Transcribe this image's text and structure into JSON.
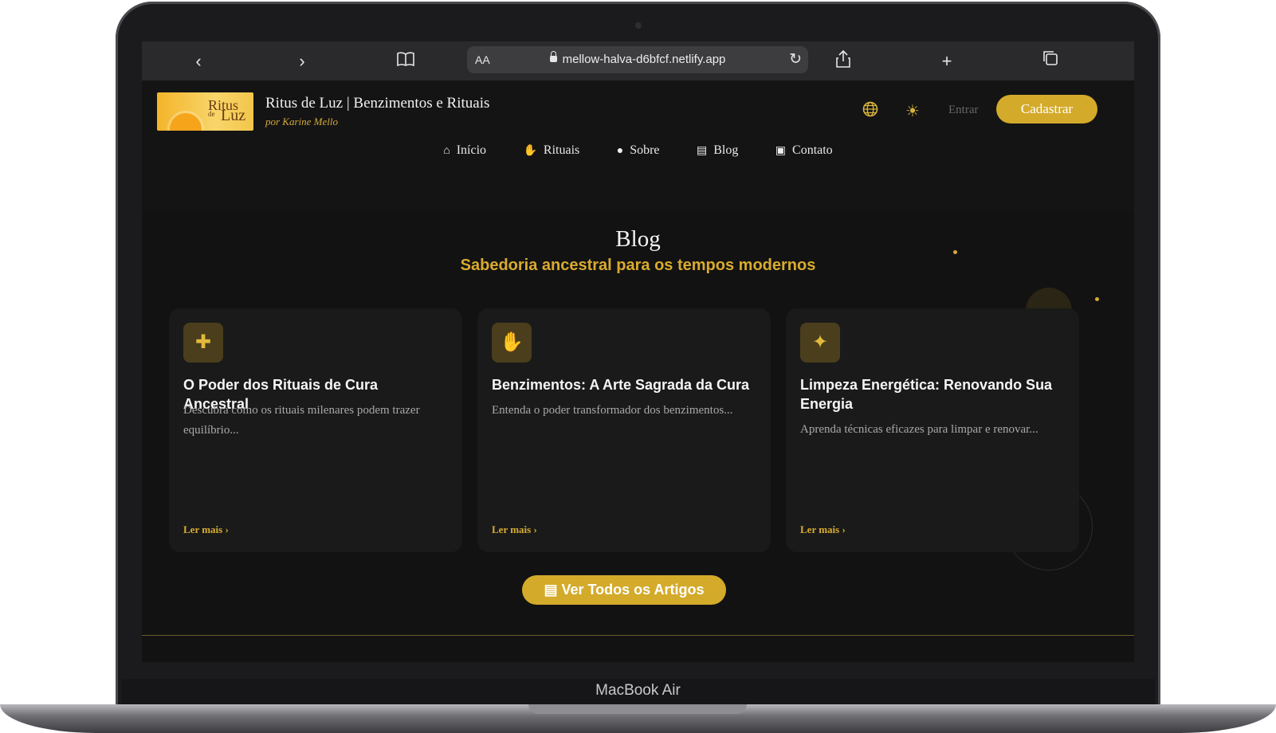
{
  "device": {
    "label": "MacBook Air"
  },
  "browser": {
    "reader_label": "AA",
    "url": "mellow-halva-d6bfcf.netlify.app",
    "icons": [
      "chevron-left-icon",
      "chevron-right-icon",
      "book-icon",
      "lock-icon",
      "reload-icon",
      "share-icon",
      "plus-icon",
      "tabs-icon"
    ]
  },
  "site": {
    "logo": {
      "line1": "Ritus",
      "line2": "de",
      "line3": "Luz"
    },
    "title": "Ritus de Luz | Benzimentos e Rituais",
    "subtitle": "por Karine Mello",
    "login_label": "Entrar",
    "signup_label": "Cadastrar",
    "nav": [
      {
        "label": "Início",
        "icon": "home-icon"
      },
      {
        "label": "Rituais",
        "icon": "hand-icon"
      },
      {
        "label": "Sobre",
        "icon": "user-icon"
      },
      {
        "label": "Blog",
        "icon": "document-icon"
      },
      {
        "label": "Contato",
        "icon": "contact-card-icon"
      }
    ]
  },
  "blog": {
    "title": "Blog",
    "subtitle": "Sabedoria ancestral para os tempos modernos",
    "cards": [
      {
        "icon": "bandage-icon",
        "title": "O Poder dos Rituais de Cura Ancestral",
        "excerpt": "Descubra como os rituais milenares podem trazer equilíbrio...",
        "more": "Ler mais"
      },
      {
        "icon": "hand-icon",
        "title": "Benzimentos: A Arte Sagrada da Cura",
        "excerpt": "Entenda o poder transformador dos benzimentos...",
        "more": "Ler mais"
      },
      {
        "icon": "sparkles-icon",
        "title": "Limpeza Energética: Renovando Sua Energia",
        "excerpt": "Aprenda técnicas eficazes para limpar e renovar...",
        "more": "Ler mais"
      }
    ],
    "all_button": "Ver Todos os Artigos"
  },
  "colors": {
    "accent": "#d4aa2b",
    "background": "#121212",
    "card": "#1a1a1a"
  }
}
